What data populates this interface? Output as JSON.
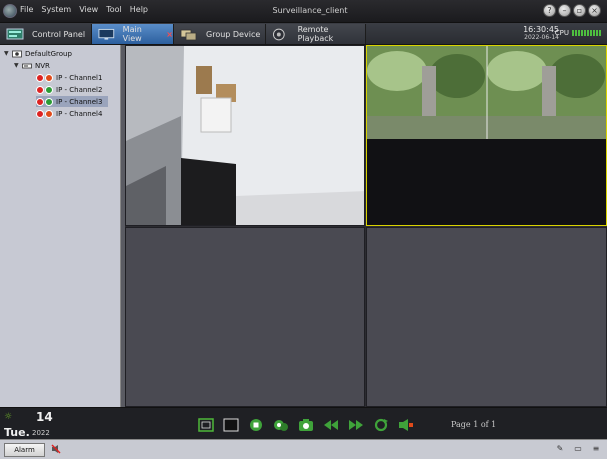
{
  "window": {
    "title": "Surveillance_client"
  },
  "menu": [
    "File",
    "System",
    "View",
    "Tool",
    "Help"
  ],
  "window_buttons": [
    "help-icon",
    "minimize-icon",
    "restore-icon",
    "close-icon"
  ],
  "tabs": [
    {
      "label": "Control Panel",
      "icon": "control-panel-icon"
    },
    {
      "label": "Main View",
      "icon": "monitor-icon",
      "active": true
    },
    {
      "label": "Group Device",
      "icon": "group-device-icon"
    },
    {
      "label": "Remote Playback",
      "icon": "playback-icon"
    }
  ],
  "status": {
    "time": "16:30:45",
    "date": "2022-06-14",
    "cpu_label": "CPU"
  },
  "tree": {
    "root": "DefaultGroup",
    "device": "NVR",
    "channels": [
      {
        "label": "IP - Channel1",
        "state": "offline"
      },
      {
        "label": "IP - Channel2",
        "state": "online"
      },
      {
        "label": "IP - Channel3",
        "state": "online",
        "selected": true
      },
      {
        "label": "IP - Channel4",
        "state": "offline"
      }
    ]
  },
  "calendar": {
    "day": "14",
    "weekday": "Tue.",
    "year": "2022"
  },
  "toolbar_icons": [
    "fullscreen-icon",
    "stop-all-icon",
    "record-icon",
    "talk-icon",
    "snapshot-icon",
    "previous-page-icon",
    "next-page-icon",
    "cycle-icon",
    "volume-icon"
  ],
  "page_info": "Page 1 of 1",
  "footer": {
    "alarm_label": "Alarm"
  },
  "colors": {
    "accent": "#2c5f9e",
    "selected_cell_border": "#d9d300",
    "cpu_meter": "#4ec03f"
  }
}
